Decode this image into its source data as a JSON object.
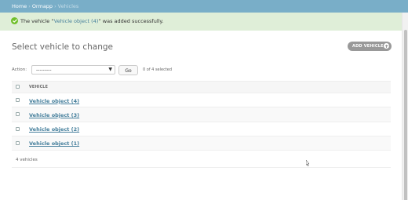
{
  "breadcrumbs": {
    "home": "Home",
    "app": "Ormapp",
    "current": "Vehicles",
    "separator": "›"
  },
  "message": {
    "prefix": "The vehicle “",
    "link": "Vehicle object (4)",
    "suffix": "” was added successfully.",
    "icon": "check-circle-icon",
    "color": "#70bf2b"
  },
  "page": {
    "title": "Select vehicle to change",
    "add_button": "ADD VEHICLE"
  },
  "actions": {
    "label": "Action:",
    "selected_value": "---------",
    "go_label": "Go",
    "selection_count": "0 of 4 selected"
  },
  "table": {
    "column_header": "VEHICLE",
    "rows": [
      {
        "name": "Vehicle object (4)"
      },
      {
        "name": "Vehicle object (3)"
      },
      {
        "name": "Vehicle object (2)"
      },
      {
        "name": "Vehicle object (1)"
      }
    ],
    "footer": "4 vehicles"
  },
  "colors": {
    "header_bar": "#79aec8",
    "success_bg": "#dfeed8",
    "link": "#447e9b"
  }
}
